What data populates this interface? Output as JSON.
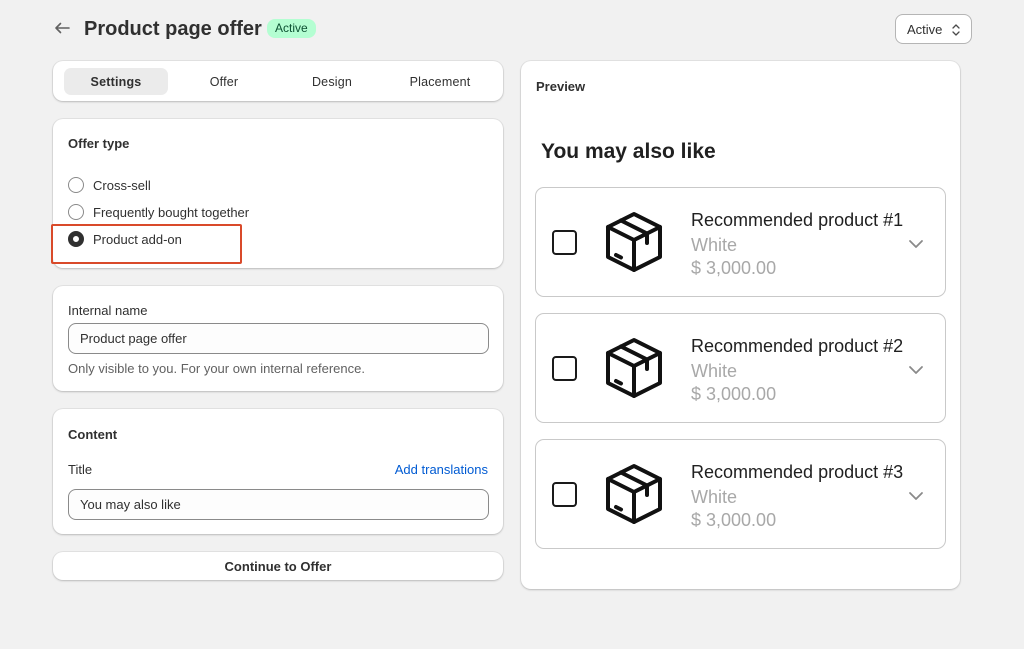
{
  "header": {
    "title": "Product page offer",
    "badge": "Active",
    "status_select": "Active"
  },
  "tabs": [
    {
      "label": "Settings"
    },
    {
      "label": "Offer"
    },
    {
      "label": "Design"
    },
    {
      "label": "Placement"
    }
  ],
  "offer_type": {
    "title": "Offer type",
    "options": [
      {
        "label": "Cross-sell",
        "selected": false
      },
      {
        "label": "Frequently bought together",
        "selected": false
      },
      {
        "label": "Product add-on",
        "selected": true
      }
    ]
  },
  "internal_name": {
    "label": "Internal name",
    "value": "Product page offer",
    "help": "Only visible to you. For your own internal reference."
  },
  "content": {
    "title": "Content",
    "field_label": "Title",
    "link": "Add translations",
    "value": "You may also like"
  },
  "continue_label": "Continue to Offer",
  "preview": {
    "label": "Preview",
    "heading": "You may also like",
    "products": [
      {
        "name": "Recommended product #1",
        "variant": "White",
        "price": "$ 3,000.00"
      },
      {
        "name": "Recommended product #2",
        "variant": "White",
        "price": "$ 3,000.00"
      },
      {
        "name": "Recommended product #3",
        "variant": "White",
        "price": "$ 3,000.00"
      }
    ]
  },
  "colors": {
    "badge_bg": "#b4fed2",
    "badge_text": "#0c5132",
    "link": "#005bd3",
    "highlight": "#d94a2a"
  }
}
